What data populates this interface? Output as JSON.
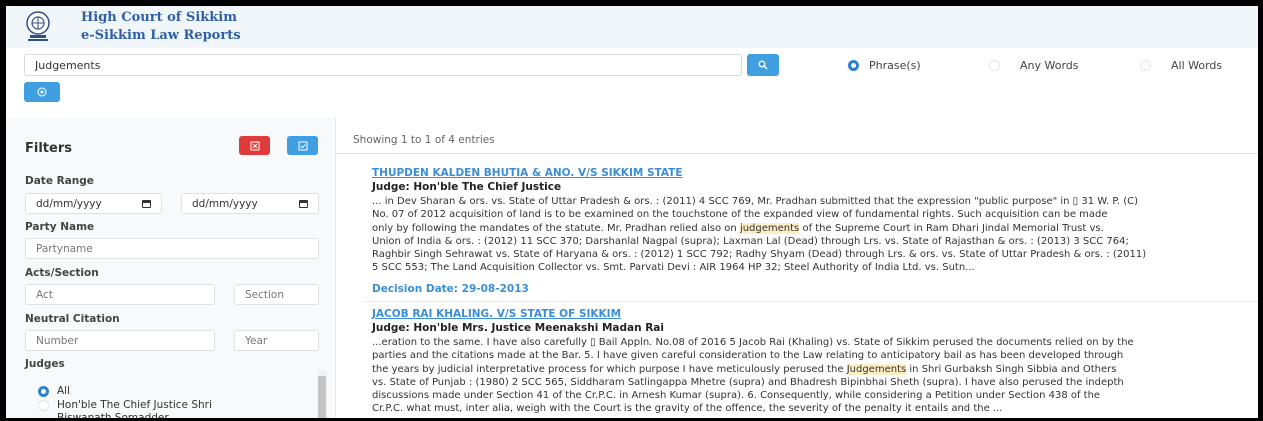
{
  "header": {
    "title_line1": "High Court of Sikkim",
    "title_line2": "e-Sikkim Law Reports",
    "logo_icon": "court-emblem-icon"
  },
  "search": {
    "query": "Judgements",
    "search_icon": "search-icon",
    "add_icon": "plus-circle-icon",
    "options": [
      {
        "label": "Phrase(s)",
        "selected": true
      },
      {
        "label": "Any Words",
        "selected": false
      },
      {
        "label": "All Words",
        "selected": false
      }
    ]
  },
  "filters": {
    "title": "Filters",
    "reset_icon": "close-box-icon",
    "apply_icon": "check-box-icon",
    "date_range_label": "Date Range",
    "date_from_value": "dd/mm/yyyy",
    "date_to_value": "dd/mm/yyyy",
    "party_name_label": "Party Name",
    "party_name_placeholder": "Partyname",
    "acts_label": "Acts/Section",
    "act_placeholder": "Act",
    "section_placeholder": "Section",
    "neutral_label": "Neutral Citation",
    "number_placeholder": "Number",
    "year_placeholder": "Year",
    "judges_label": "Judges",
    "judges": [
      {
        "label": "All",
        "selected": true
      },
      {
        "label": "Hon'ble The Chief Justice Shri\nBiswanath Somadder",
        "selected": false
      }
    ]
  },
  "results": {
    "showing": "Showing 1 to 1 of 4 entries",
    "items": [
      {
        "title": "THUPDEN KALDEN BHUTIA & ANO. V/S SIKKIM STATE",
        "judge": "Judge: Hon'ble The Chief Justice",
        "snippet_pre": "... in Dev Sharan & ors. vs. State of Uttar Pradesh & ors. : (2011) 4 SCC 769, Mr. Pradhan submitted that the expression \"public purpose\" in ▯ 31 W. P. (C)\nNo. 07 of 2012 acquisition of land is to be examined on the touchstone of the expanded view of fundamental rights. Such acquisition can be made\nonly by following the mandates of the statute. Mr. Pradhan relied also on ",
        "snippet_mark": "judgements",
        "snippet_post": " of the Supreme Court in Ram Dhari Jindal Memorial Trust vs.\nUnion of India & ors. : (2012) 11 SCC 370; Darshanlal Nagpal (supra); Laxman Lal (Dead) through Lrs. vs. State of Rajasthan & ors. : (2013) 3 SCC 764;\nRaghbir Singh Sehrawat vs. State of Haryana & ors. : (2012) 1 SCC 792; Radhy Shyam (Dead) through Lrs. & ors. vs. State of Uttar Pradesh & ors. : (2011)\n5 SCC 553; The Land Acquisition Collector vs. Smt. Parvati Devi : AIR 1964 HP 32; Steel Authority of India Ltd. vs. Sutn...",
        "date": "Decision Date: 29-08-2013"
      },
      {
        "title": "JACOB RAI KHALING. V/S STATE OF SIKKIM",
        "judge": "Judge: Hon'ble Mrs. Justice Meenakshi Madan Rai",
        "snippet_pre": "...eration to the same. I have also carefully ▯ Bail Appln. No.08 of 2016 5 Jacob Rai (Khaling) vs. State of Sikkim perused the documents relied on by the\nparties and the citations made at the Bar. 5. I have given careful consideration to the Law relating to anticipatory bail as has been developed through\nthe years by judicial interpretative process for which purpose I have meticulously perused the ",
        "snippet_mark": "Judgements",
        "snippet_post": " in Shri Gurbaksh Singh Sibbia and Others\nvs. State of Punjab : (1980) 2 SCC 565, Siddharam Satlingappa Mhetre (supra) and Bhadresh Bipinbhai Sheth (supra). I have also perused the indepth\ndiscussions made under Section 41 of the Cr.P.C. in Arnesh Kumar (supra). 6. Consequently, while considering a Petition under Section 438 of the\nCr.P.C. what must, inter alia, weigh with the Court is the gravity of the offence, the severity of the penalty it entails and the ..."
      }
    ]
  }
}
